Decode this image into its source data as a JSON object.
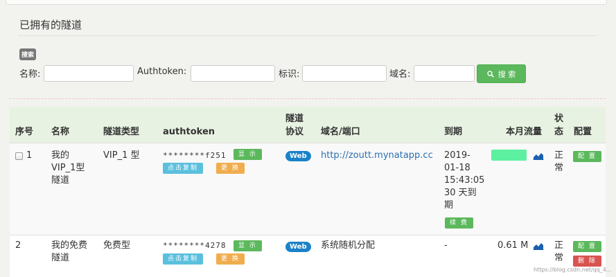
{
  "section": {
    "title": "已拥有的隧道"
  },
  "search": {
    "badge": "搜索",
    "name_label": "名称:",
    "authtoken_label": "Authtoken:",
    "tag_label": "标识:",
    "domain_label": "域名:",
    "button_label": "搜 索"
  },
  "table": {
    "headers": {
      "index": "序号",
      "name": "名称",
      "type": "隧道类型",
      "authtoken": "authtoken",
      "protocol_1": "隧道",
      "protocol_2": "协议",
      "domain": "域名/端口",
      "expiry": "到期",
      "traffic": "本月流量",
      "status_1": "状",
      "status_2": "态",
      "config": "配置"
    },
    "rows": [
      {
        "index": "1",
        "name_lines": [
          "我的",
          "VIP_1型",
          "隧道"
        ],
        "type": "VIP_1 型",
        "token": "********f251",
        "show_btn": "显 示",
        "copy_btn": "点击复制",
        "change_btn": "更 换",
        "protocol": "Web",
        "domain": "http://zoutt.mynatapp.cc",
        "expiry_lines": [
          "2019-",
          "01-18",
          "15:43:05",
          "30 天到",
          "期"
        ],
        "renew_btn": "续 费",
        "traffic": "",
        "status_lines": [
          "正",
          "常"
        ],
        "config_btn": "配 置"
      },
      {
        "index": "2",
        "name_lines": [
          "我的免费",
          "隧道"
        ],
        "type": "免费型",
        "token": "********4278",
        "show_btn": "显 示",
        "copy_btn": "点击复制",
        "change_btn": "更 换",
        "protocol": "Web",
        "domain": "系统随机分配",
        "expiry_lines": [
          "-"
        ],
        "traffic": "0.61 M",
        "status_lines": [
          "正",
          "常"
        ],
        "config_btn": "配 置",
        "delete_btn": "删 除"
      }
    ]
  },
  "watermark": "https://blog.csdn.net/qq_4...",
  "colors": {
    "green": "#5cb85c",
    "blue": "#5bc0de",
    "orange": "#f0ad4e",
    "red": "#d9534f",
    "web_badge": "#1b82c9",
    "traffic_bar": "#5cf0a0"
  },
  "icons": [
    "search-icon",
    "area-chart-icon"
  ]
}
